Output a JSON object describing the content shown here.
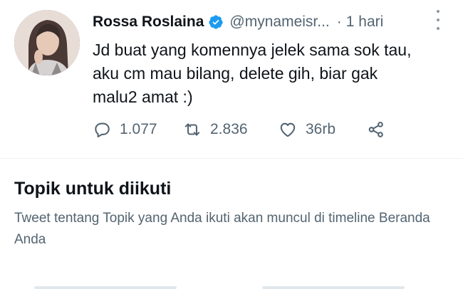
{
  "tweet": {
    "author_name": "Rossa Roslaina",
    "handle": "@mynameisr...",
    "separator": "·",
    "time": "1 hari",
    "text_lines": [
      "Jd buat yang komennya jelek sama sok tau,",
      "aku cm mau bilang, delete gih, biar gak",
      "malu2 amat :)"
    ],
    "replies": "1.077",
    "retweets": "2.836",
    "likes": "36rb"
  },
  "topics": {
    "title": "Topik untuk diikuti",
    "description": "Tweet tentang Topik yang Anda ikuti akan muncul di timeline Beranda Anda"
  },
  "colors": {
    "verified": "#1d9bf0",
    "secondary_text": "#536471",
    "icon_gray": "#536471"
  }
}
